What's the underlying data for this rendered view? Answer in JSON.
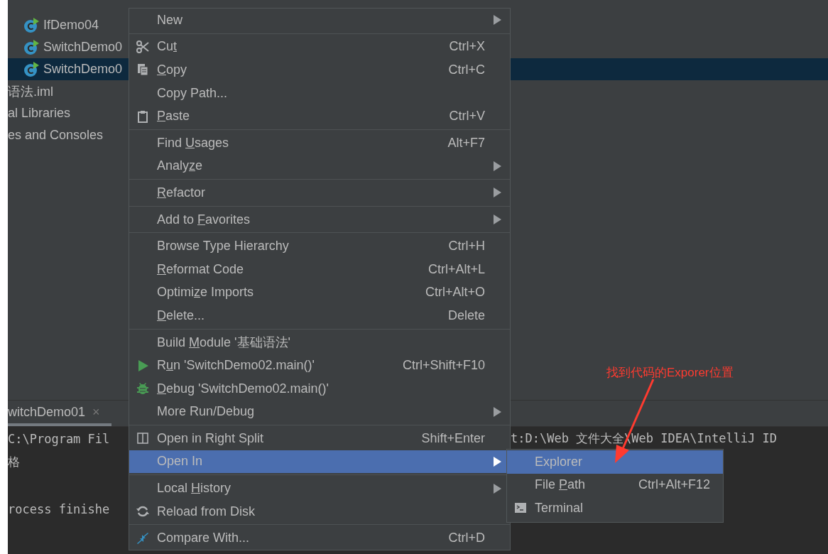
{
  "project_tree": {
    "items": [
      {
        "label": "IfDemo04",
        "kind": "class",
        "selected": false
      },
      {
        "label": "SwitchDemo0",
        "kind": "class",
        "selected": false
      },
      {
        "label": "SwitchDemo0",
        "kind": "class",
        "selected": true
      },
      {
        "label": "语法.iml",
        "kind": "file",
        "selected": false
      },
      {
        "label": "al Libraries",
        "kind": "file",
        "selected": false
      },
      {
        "label": "es and Consoles",
        "kind": "file",
        "selected": false
      }
    ]
  },
  "run_panel": {
    "tabs": [
      {
        "label": "witchDemo01",
        "close": "×",
        "selected": true
      }
    ],
    "console_lines": [
      {
        "left": "C:\\Program Fil",
        "right": "t:D:\\Web 文件大全\\Web IDEA\\IntelliJ ID"
      },
      {
        "left": "格"
      },
      {
        "left": "rocess finishe"
      }
    ]
  },
  "context_menu": {
    "groups": [
      [
        {
          "label": "New",
          "submenu": true,
          "selected": false
        }
      ],
      [
        {
          "label": "Cut",
          "shortcut": "Ctrl+X",
          "selected": false
        },
        {
          "label": "Copy",
          "shortcut": "Ctrl+C",
          "selected": false
        },
        {
          "label": "Copy Path...",
          "selected": false
        },
        {
          "label": "Paste",
          "shortcut": "Ctrl+V",
          "selected": false
        }
      ],
      [
        {
          "label": "Find Usages",
          "shortcut": "Alt+F7",
          "selected": false
        },
        {
          "label": "Analyze",
          "submenu": true,
          "selected": false
        }
      ],
      [
        {
          "label": "Refactor",
          "submenu": true,
          "selected": false
        }
      ],
      [
        {
          "label": "Add to Favorites",
          "submenu": true,
          "selected": false
        }
      ],
      [
        {
          "label": "Browse Type Hierarchy",
          "shortcut": "Ctrl+H",
          "selected": false
        },
        {
          "label": "Reformat Code",
          "shortcut": "Ctrl+Alt+L",
          "selected": false
        },
        {
          "label": "Optimize Imports",
          "shortcut": "Ctrl+Alt+O",
          "selected": false
        },
        {
          "label": "Delete...",
          "shortcut": "Delete",
          "selected": false
        }
      ],
      [
        {
          "label": "Build Module '基础语法'",
          "selected": false
        },
        {
          "label": "Run 'SwitchDemo02.main()'",
          "shortcut": "Ctrl+Shift+F10",
          "selected": false
        },
        {
          "label": "Debug 'SwitchDemo02.main()'",
          "selected": false
        },
        {
          "label": "More Run/Debug",
          "submenu": true,
          "selected": false
        }
      ],
      [
        {
          "label": "Open in Right Split",
          "shortcut": "Shift+Enter",
          "selected": false
        },
        {
          "label": "Open In",
          "submenu": true,
          "selected": true
        }
      ],
      [
        {
          "label": "Local History",
          "submenu": true,
          "selected": false
        },
        {
          "label": "Reload from Disk",
          "selected": false
        }
      ],
      [
        {
          "label": "Compare With...",
          "shortcut": "Ctrl+D",
          "selected": false
        }
      ]
    ]
  },
  "submenu": {
    "items": [
      {
        "label": "Explorer",
        "selected": true
      },
      {
        "label": "File Path",
        "shortcut": "Ctrl+Alt+F12",
        "selected": false
      },
      {
        "label": "Terminal",
        "selected": false
      }
    ]
  },
  "annotation": {
    "text": "找到代码的Exporer位置"
  }
}
